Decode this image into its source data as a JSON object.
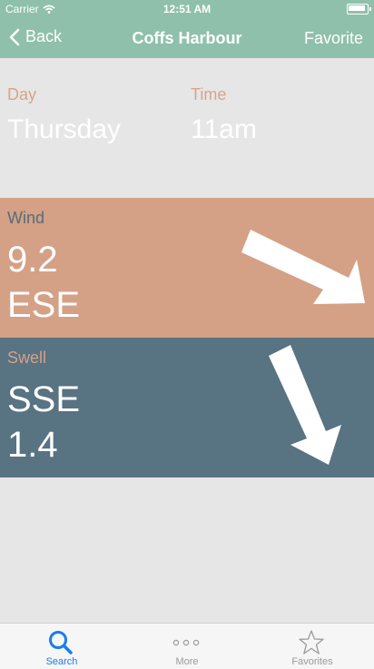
{
  "status_bar": {
    "carrier": "Carrier",
    "time": "12:51 AM"
  },
  "nav": {
    "back_label": "Back",
    "title": "Coffs Harbour",
    "favorite_label": "Favorite"
  },
  "info": {
    "day_label": "Day",
    "day_value": "Thursday",
    "time_label": "Time",
    "time_value": "11am"
  },
  "wind": {
    "label": "Wind",
    "speed": "9.2",
    "direction": "ESE"
  },
  "swell": {
    "label": "Swell",
    "direction": "SSE",
    "height": "1.4"
  },
  "tabs": [
    {
      "label": "Search",
      "icon": "search-icon",
      "color": "#1a7cf0"
    },
    {
      "label": "More",
      "icon": "more-icon",
      "color": "#9a9a9a"
    },
    {
      "label": "Favorites",
      "icon": "star-icon",
      "color": "#9a9a9a"
    }
  ],
  "colors": {
    "nav_bg": "#8fc0ab",
    "wind_bg": "#d4a186",
    "swell_bg": "#587382",
    "accent": "#1a7cf0"
  }
}
